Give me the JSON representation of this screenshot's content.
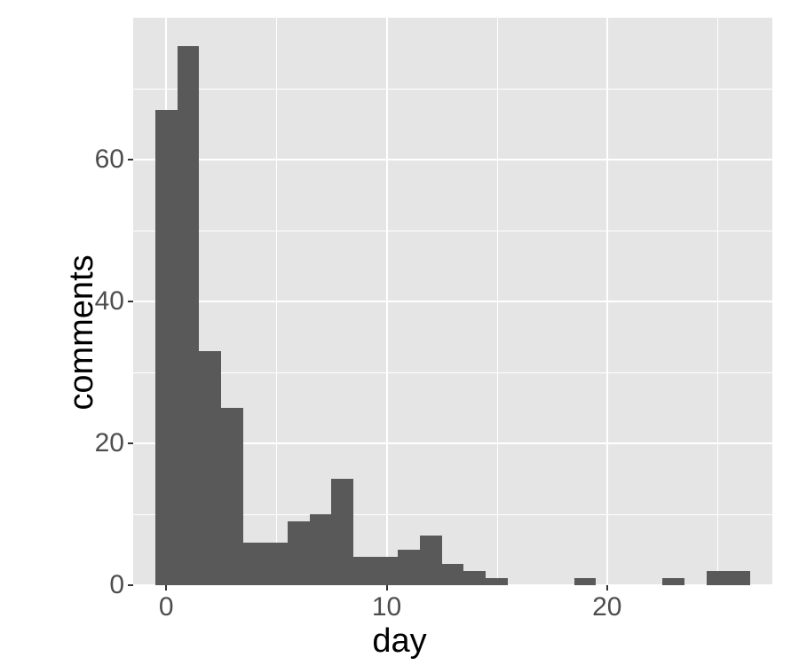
{
  "chart_data": {
    "type": "bar",
    "xlabel": "day",
    "ylabel": "comments",
    "title": "",
    "xlim": [
      -1.5,
      27.5
    ],
    "ylim": [
      0,
      80
    ],
    "x_ticks": [
      0,
      10,
      20
    ],
    "y_ticks": [
      0,
      20,
      40,
      60
    ],
    "x_minor": [
      5,
      15,
      25
    ],
    "y_minor": [
      10,
      30,
      50,
      70
    ],
    "categories": [
      0,
      1,
      2,
      3,
      4,
      5,
      6,
      7,
      8,
      9,
      10,
      11,
      12,
      13,
      14,
      15,
      16,
      17,
      18,
      19,
      20,
      21,
      22,
      23,
      24,
      25,
      26
    ],
    "values": [
      67,
      76,
      33,
      25,
      6,
      6,
      9,
      10,
      15,
      4,
      4,
      5,
      7,
      3,
      2,
      1,
      0,
      0,
      0,
      1,
      0,
      0,
      0,
      1,
      0,
      2,
      2
    ]
  }
}
